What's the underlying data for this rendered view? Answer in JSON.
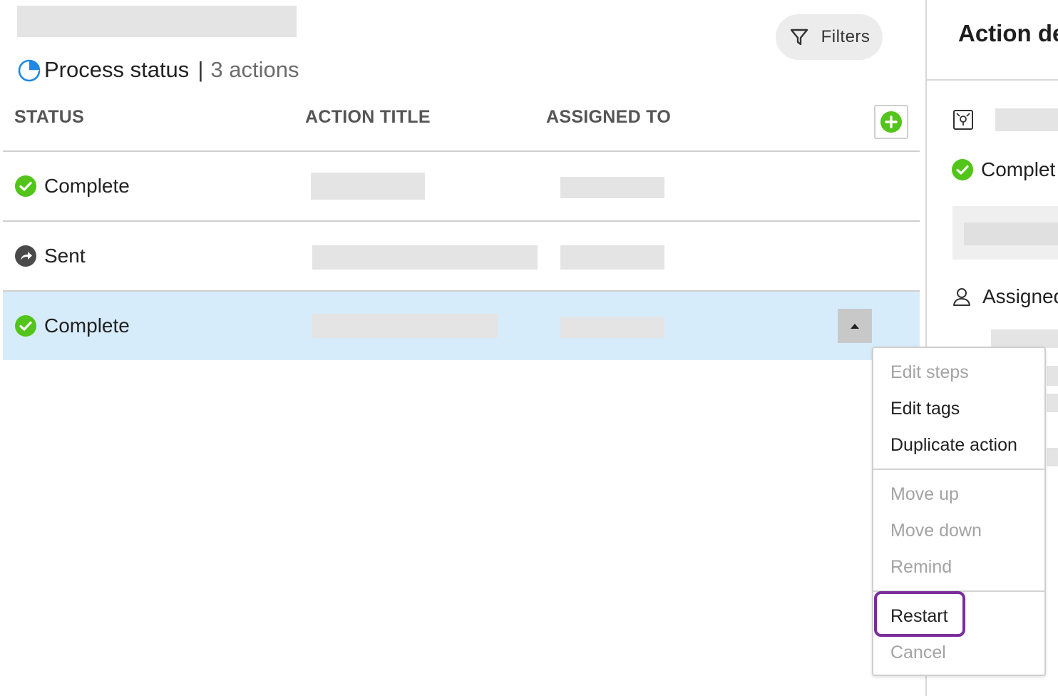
{
  "header": {
    "title": "Process status",
    "separator": "|",
    "count": "3 actions",
    "filters_label": "Filters"
  },
  "columns": {
    "status": "STATUS",
    "action_title": "ACTION TITLE",
    "assigned_to": "ASSIGNED TO"
  },
  "rows": [
    {
      "status": "Complete",
      "status_icon": "check-circle-icon",
      "selected": false
    },
    {
      "status": "Sent",
      "status_icon": "share-arrow-icon",
      "selected": false
    },
    {
      "status": "Complete",
      "status_icon": "check-circle-icon",
      "selected": true
    }
  ],
  "menu": {
    "items": [
      {
        "label": "Edit steps",
        "enabled": false
      },
      {
        "label": "Edit tags",
        "enabled": true
      },
      {
        "label": "Duplicate action",
        "enabled": true
      },
      {
        "label": "Move up",
        "enabled": false
      },
      {
        "label": "Move down",
        "enabled": false
      },
      {
        "label": "Remind",
        "enabled": false
      },
      {
        "label": "Restart",
        "enabled": true,
        "highlighted": true
      },
      {
        "label": "Cancel",
        "enabled": false
      }
    ]
  },
  "side_panel": {
    "title": "Action de",
    "status": "Complet",
    "assigned_label": "Assigned"
  },
  "colors": {
    "success": "#52c41a",
    "selected_row": "#d6ecfb",
    "highlight": "#7b2d9b",
    "accent_blue": "#1e88e5"
  }
}
